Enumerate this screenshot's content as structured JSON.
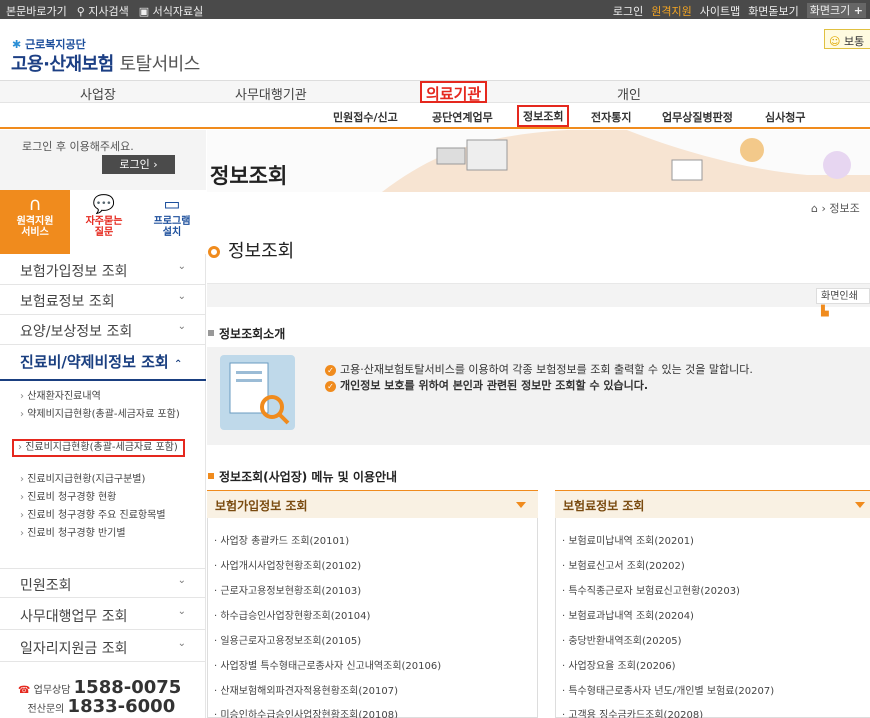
{
  "utility": {
    "skip": "본문바로가기",
    "branch": "지사검색",
    "forms": "서식자료실",
    "login": "로그인",
    "remote": "원격지원",
    "sitemap": "사이트맵",
    "zoom": "화면돋보기",
    "font": "화면크기"
  },
  "brand": {
    "org": "근로복지공단",
    "name": "고용·산재보험",
    "suffix": "토탈서비스",
    "bot": "보통"
  },
  "topnav": [
    "사업장",
    "사무대행기관",
    "의료기관",
    "개인"
  ],
  "subnav": [
    "민원접수/신고",
    "공단연계업무",
    "정보조회",
    "전자통지",
    "업무상질병판정",
    "심사청구"
  ],
  "login": {
    "msg": "로그인 후 이용해주세요.",
    "btn": "로그인"
  },
  "quick": [
    {
      "label": "원격지원\n서비스"
    },
    {
      "label": "자주묻는\n질문"
    },
    {
      "label": "프로그램\n설치"
    }
  ],
  "sidemenu": [
    "보험가입정보 조회",
    "보험료정보 조회",
    "요양/보상정보 조회",
    "진료비/약제비정보 조회"
  ],
  "submenu": [
    "산재환자진료내역",
    "약제비지급현황(총괄-세금자료 포함)",
    "진료비지급현황(총괄-세금자료 포함)",
    "진료비지급현황(지급구분별)",
    "진료비 청구경향 현황",
    "진료비 청구경향 주요 진료항목별",
    "진료비 청구경향 반기별"
  ],
  "sidemenu2": [
    "민원조회",
    "사무대행업무 조회",
    "일자리지원금 조회"
  ],
  "contact": {
    "l1": "업무상담",
    "n1": "1588-0075",
    "l2": "전산문의",
    "n2": "1833-6000"
  },
  "page": {
    "banner": "정보조회",
    "crumb": "정보조",
    "title": "정보조회",
    "print": "화면인쇄"
  },
  "intro": {
    "heading": "정보조회소개",
    "line1": "고용·산재보험토탈서비스를 이용하여 각종 보험정보를 조회 출력할 수 있는 것을 말합니다.",
    "line2": "개인정보 보호를 위하여 본인과 관련된 정보만 조회할 수 있습니다."
  },
  "menu_heading": "정보조회(사업장) 메뉴 및 이용안내",
  "card1": {
    "title": "보험가입정보 조회",
    "items": [
      "사업장 총괄카드 조회(20101)",
      "사업개시사업장현황조회(20102)",
      "근로자고용정보현황조회(20103)",
      "하수급승인사업장현황조회(20104)",
      "일용근로자고용정보조회(20105)",
      "사업장별 특수형태근로종사자 신고내역조회(20106)",
      "산재보험해외파견자적용현황조회(20107)",
      "미승인하수급승인사업장현황조회(20108)"
    ]
  },
  "card2": {
    "title": "보험료정보 조회",
    "items": [
      "보험료미납내역 조회(20201)",
      "보험료신고서 조회(20202)",
      "특수직종근로자 보험료신고현황(20203)",
      "보험료과납내역 조회(20204)",
      "충당반환내역조회(20205)",
      "사업장요율 조회(20206)",
      "특수형태근로종사자 년도/개인별 보험료(20207)",
      "고객용 징수금카드조회(20208)"
    ]
  }
}
